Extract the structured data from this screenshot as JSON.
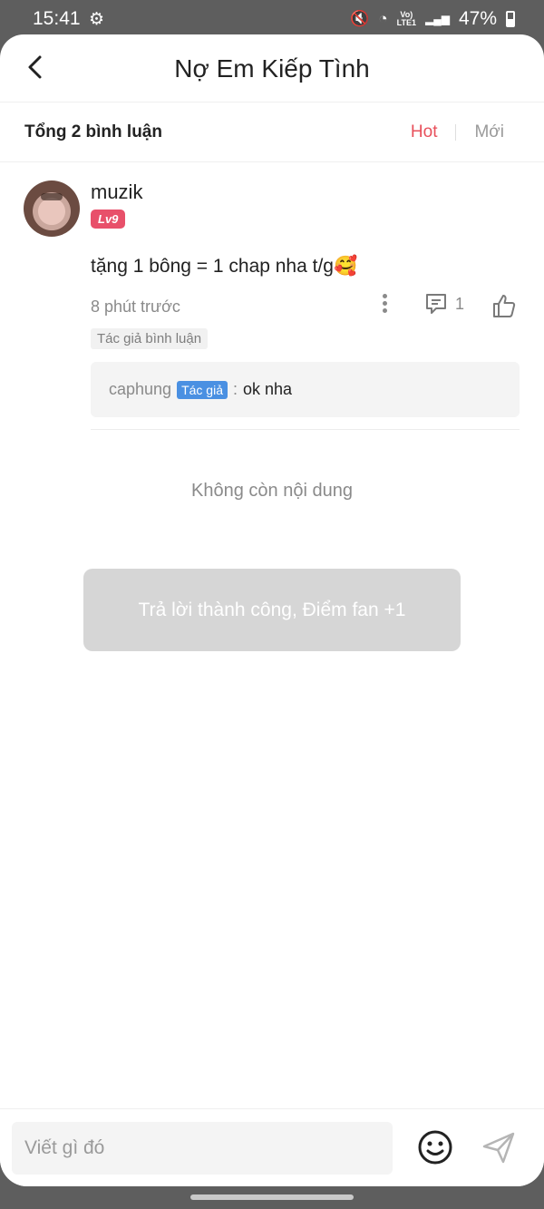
{
  "status_bar": {
    "time": "15:41",
    "gear_glyph": "⚙",
    "mute_glyph": "🔇",
    "wifi_glyph": "◔",
    "network_volte": "Vo)",
    "network_lte": "LTE1",
    "signal_glyph": "▂▄▆",
    "battery": "47%"
  },
  "header": {
    "title": "Nợ Em Kiếp Tình"
  },
  "subheader": {
    "total": "Tổng 2 bình luận",
    "tabs": [
      {
        "label": "Hot",
        "active": true
      },
      {
        "label": "Mới",
        "active": false
      }
    ]
  },
  "comment": {
    "username": "muzik",
    "level": "Lv9",
    "text": "tặng 1 bông = 1 chap nha t/g🥰",
    "time": "8 phút trước",
    "reply_count": "1",
    "author_tag": "Tác giả bình luận",
    "reply": {
      "user": "caphung",
      "badge": "Tác giả",
      "separator": ":",
      "text": "ok nha"
    }
  },
  "no_more": "Không còn nội dung",
  "toast": "Trả lời thành công, Điểm fan +1",
  "composer": {
    "placeholder": "Viết gì đó"
  },
  "colors": {
    "accent": "#e8505b",
    "level_badge": "#e8506a",
    "author_badge": "#4a90e2"
  }
}
